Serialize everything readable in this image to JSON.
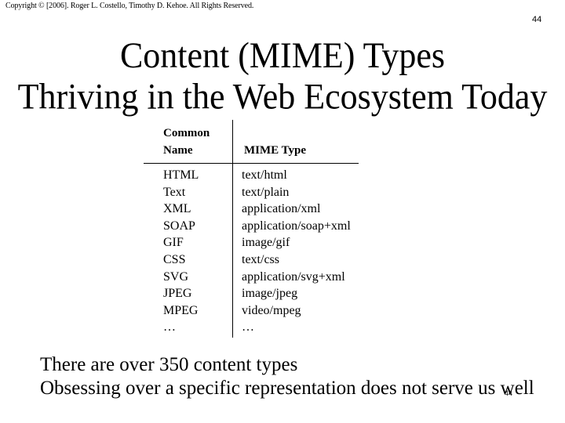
{
  "slide": {
    "copyright": "Copyright © [2006]. Roger L. Costello, Timothy D. Kehoe. All Rights Reserved.",
    "page_number": "44",
    "title_lines": [
      "Content (MIME) Types",
      "Thriving in the Web Ecosystem Today"
    ],
    "table": {
      "headers": {
        "common_name": "Common\nName",
        "common_name_line1": "Common",
        "common_name_line2": "Name",
        "mime_type": "MIME Type"
      },
      "rows": [
        {
          "name": "HTML",
          "mime": "text/html"
        },
        {
          "name": "Text",
          "mime": "text/plain"
        },
        {
          "name": "XML",
          "mime": "application/xml"
        },
        {
          "name": "SOAP",
          "mime": "application/soap+xml"
        },
        {
          "name": "GIF",
          "mime": "image/gif"
        },
        {
          "name": "CSS",
          "mime": "text/css"
        },
        {
          "name": "SVG",
          "mime": "application/svg+xml"
        },
        {
          "name": "JPEG",
          "mime": "image/jpeg"
        },
        {
          "name": "MPEG",
          "mime": "video/mpeg"
        },
        {
          "name": "…",
          "mime": "…"
        }
      ]
    },
    "bullets": [
      "There are over 350 content types",
      "Obsessing over a specific representation does not serve us well"
    ],
    "page_number_bottom": "44"
  }
}
